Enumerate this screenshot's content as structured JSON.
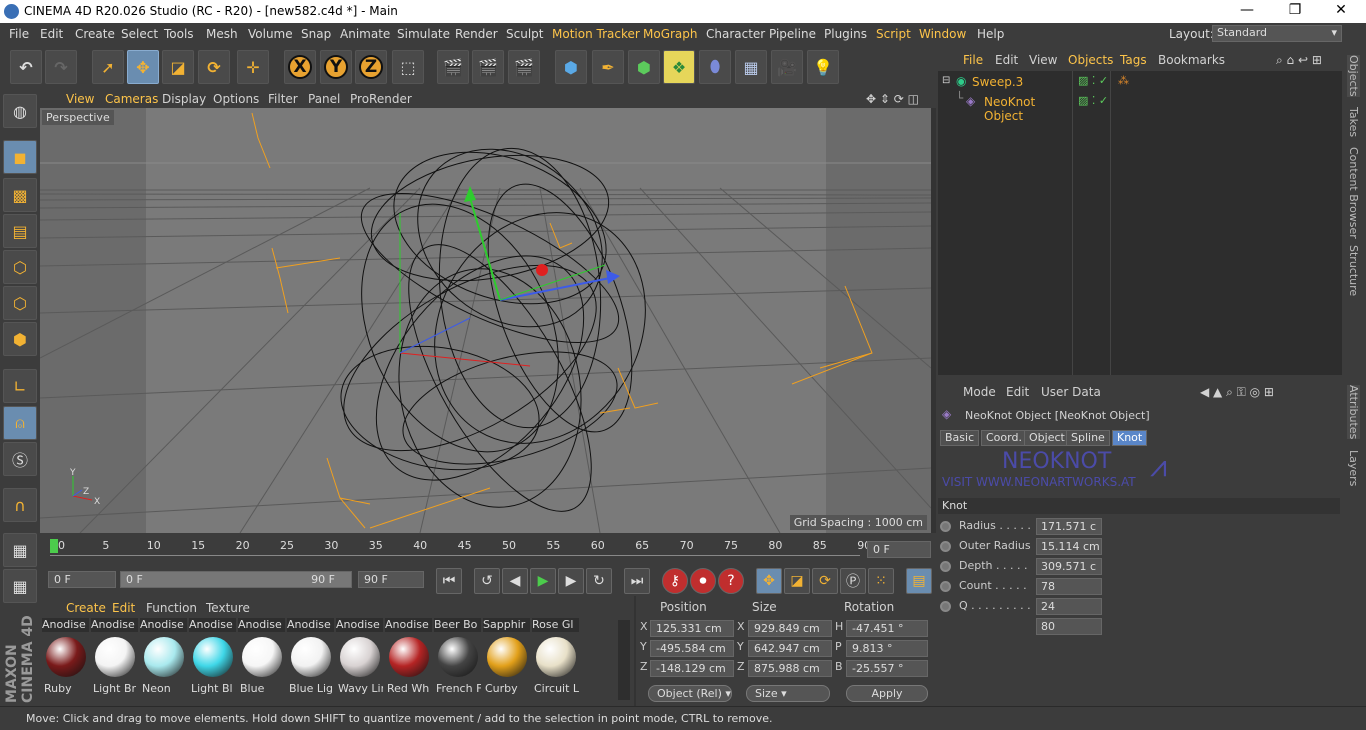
{
  "title": "CINEMA 4D R20.026 Studio (RC - R20) - [new582.c4d *] - Main",
  "window": {
    "minimize": "—",
    "maximize": "❐",
    "close": "✕"
  },
  "menu": [
    "File",
    "Edit",
    "Create",
    "Select",
    "Tools",
    "Mesh",
    "Volume",
    "Snap",
    "Animate",
    "Simulate",
    "Render",
    "Sculpt",
    "Motion Tracker",
    "MoGraph",
    "Character",
    "Pipeline",
    "Plugins",
    "Script",
    "Window",
    "Help"
  ],
  "layout": {
    "label": "Layout:",
    "value": "Standard"
  },
  "viewport_menu": [
    "View",
    "Cameras",
    "Display",
    "Options",
    "Filter",
    "Panel",
    "ProRender"
  ],
  "viewport": {
    "camera": "Perspective",
    "grid_spacing": "Grid Spacing : 1000 cm"
  },
  "timeline": {
    "ticks": [
      "0",
      "5",
      "10",
      "15",
      "20",
      "25",
      "30",
      "35",
      "40",
      "45",
      "50",
      "55",
      "60",
      "65",
      "70",
      "75",
      "80",
      "85",
      "90"
    ],
    "current": "0 F"
  },
  "playback": {
    "start": "0 F",
    "range_start": "0 F",
    "range_end": "90 F",
    "end": "90 F"
  },
  "materials": {
    "tabs": [
      "Create",
      "Edit",
      "Function",
      "Texture"
    ],
    "items": [
      {
        "top": "Anodise",
        "label": "Ruby",
        "color": "#7a1a1a"
      },
      {
        "top": "Anodise",
        "label": "Light Br",
        "color": "#f4f4f4"
      },
      {
        "top": "Anodise",
        "label": "Neon",
        "color": "#a9e9ee"
      },
      {
        "top": "Anodise",
        "label": "Light Bl",
        "color": "#3fd7e8"
      },
      {
        "top": "Anodise",
        "label": "Blue",
        "color": "#f6f6f6"
      },
      {
        "top": "Anodise",
        "label": "Blue Lig",
        "color": "#f2f2f2"
      },
      {
        "top": "Anodise",
        "label": "Wavy Lin",
        "color": "#d8d2d2"
      },
      {
        "top": "Anodise",
        "label": "Red Wh",
        "color": "#b52424"
      },
      {
        "top": "Beer Bo",
        "label": "French F",
        "color": "#444"
      },
      {
        "top": "Sapphir",
        "label": "Curby",
        "color": "#e2a01a"
      },
      {
        "top": "Rose Gl",
        "label": "Circuit L",
        "color": "#e8e0c8"
      }
    ]
  },
  "coords": {
    "headers": [
      "Position",
      "Size",
      "Rotation"
    ],
    "rows": [
      {
        "axis": "X",
        "pos": "125.331 cm",
        "saxis": "X",
        "size": "929.849 cm",
        "raxis": "H",
        "rot": "-47.451 °"
      },
      {
        "axis": "Y",
        "pos": "-495.584 cm",
        "saxis": "Y",
        "size": "642.947 cm",
        "raxis": "P",
        "rot": "9.813 °"
      },
      {
        "axis": "Z",
        "pos": "-148.129 cm",
        "saxis": "Z",
        "size": "875.988 cm",
        "raxis": "B",
        "rot": "-25.557 °"
      }
    ],
    "mode": "Object (Rel)",
    "size_mode": "Size",
    "apply": "Apply"
  },
  "status": "Move: Click and drag to move elements. Hold down SHIFT to quantize movement / add to the selection in point mode, CTRL to remove.",
  "object_manager": {
    "menu": [
      "File",
      "Edit",
      "View",
      "Objects",
      "Tags",
      "Bookmarks"
    ],
    "objects": [
      {
        "name": "Sweep.3",
        "color": "#f2b233"
      },
      {
        "name": "NeoKnot Object",
        "color": "#f2b233"
      }
    ]
  },
  "side_tabs": [
    "Objects",
    "Takes",
    "Content Browser",
    "Structure",
    "Attributes",
    "Layers"
  ],
  "attributes": {
    "menu": [
      "Mode",
      "Edit",
      "User Data"
    ],
    "object": "NeoKnot Object [NeoKnot Object]",
    "tabs": [
      "Basic",
      "Coord.",
      "Object",
      "Spline",
      "Knot"
    ],
    "banner": "NEOKNOT",
    "banner_sub": "VISIT WWW.NEONARTWORKS.AT",
    "section": "Knot",
    "params": [
      {
        "label": "Radius . . . . .",
        "value": "171.571 c"
      },
      {
        "label": "Outer Radius",
        "value": "15.114 cm"
      },
      {
        "label": "Depth . . . . .",
        "value": "309.571 c"
      },
      {
        "label": "Count . . . . .",
        "value": "78"
      },
      {
        "label": "Q . . . . . . . . .",
        "value": "24"
      },
      {
        "label": "",
        "value": "80"
      }
    ]
  },
  "brand": "MAXON CINEMA 4D"
}
